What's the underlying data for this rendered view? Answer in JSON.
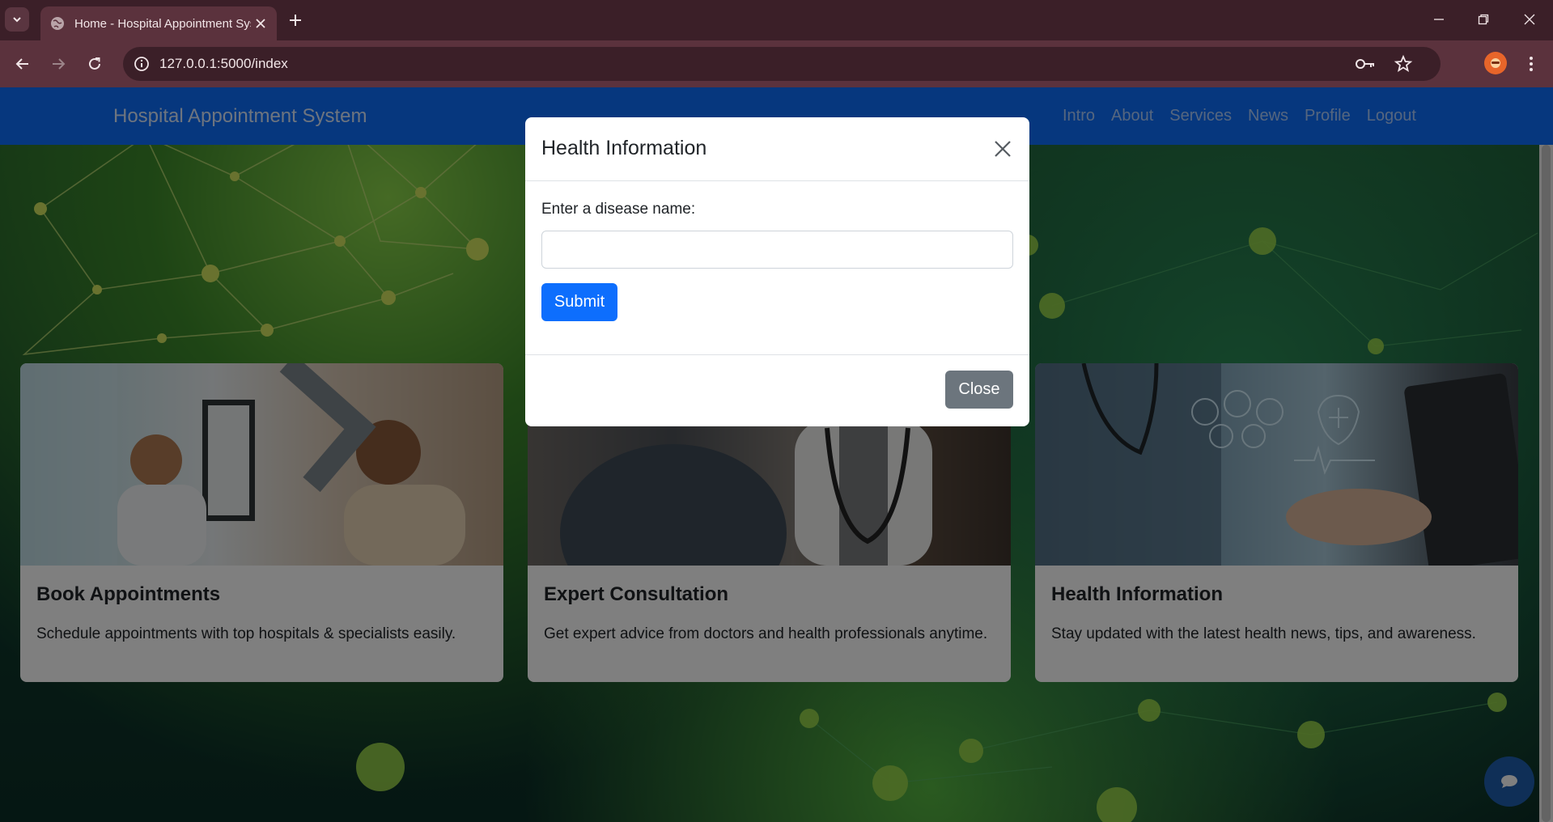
{
  "browser": {
    "tab_title": "Home - Hospital Appointment System",
    "url": "127.0.0.1:5000/index",
    "icons": [
      "tab-search-icon",
      "globe-icon",
      "close-icon",
      "plus-icon",
      "minimize-icon",
      "restore-icon",
      "window-close-icon",
      "back-icon",
      "forward-icon",
      "reload-icon",
      "site-info-icon",
      "key-icon",
      "star-icon",
      "profile-avatar",
      "kebab-menu-icon"
    ]
  },
  "navbar": {
    "brand": "Hospital Appointment System",
    "links": [
      "Intro",
      "About",
      "Services",
      "News",
      "Profile",
      "Logout"
    ]
  },
  "cards": [
    {
      "title": "Book Appointments",
      "text": "Schedule appointments with top hospitals & specialists easily."
    },
    {
      "title": "Expert Consultation",
      "text": "Get expert advice from doctors and health professionals anytime."
    },
    {
      "title": "Health Information",
      "text": "Stay updated with the latest health news, tips, and awareness."
    }
  ],
  "modal": {
    "title": "Health Information",
    "label": "Enter a disease name:",
    "input_value": "",
    "submit_label": "Submit",
    "close_label": "Close"
  },
  "colors": {
    "primary": "#0d6efd",
    "secondary": "#6c757d",
    "chrome": "#5b323d"
  }
}
